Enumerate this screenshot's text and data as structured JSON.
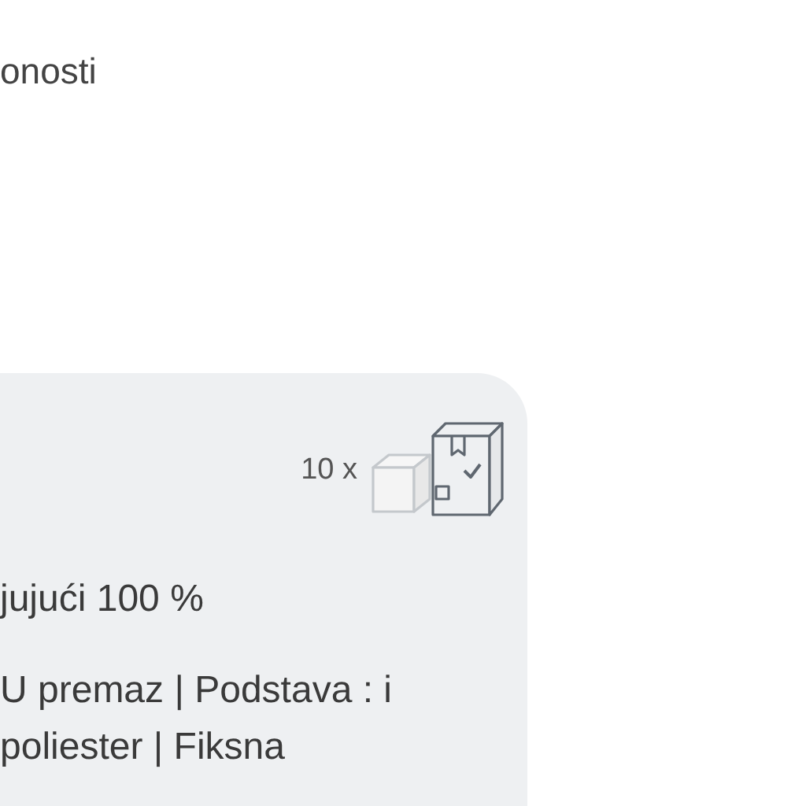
{
  "heading": "onosti",
  "card": {
    "quantity": "10 x",
    "material": "jujući 100 %",
    "description": "U premaz | Podstava : i poliester | Fiksna"
  }
}
